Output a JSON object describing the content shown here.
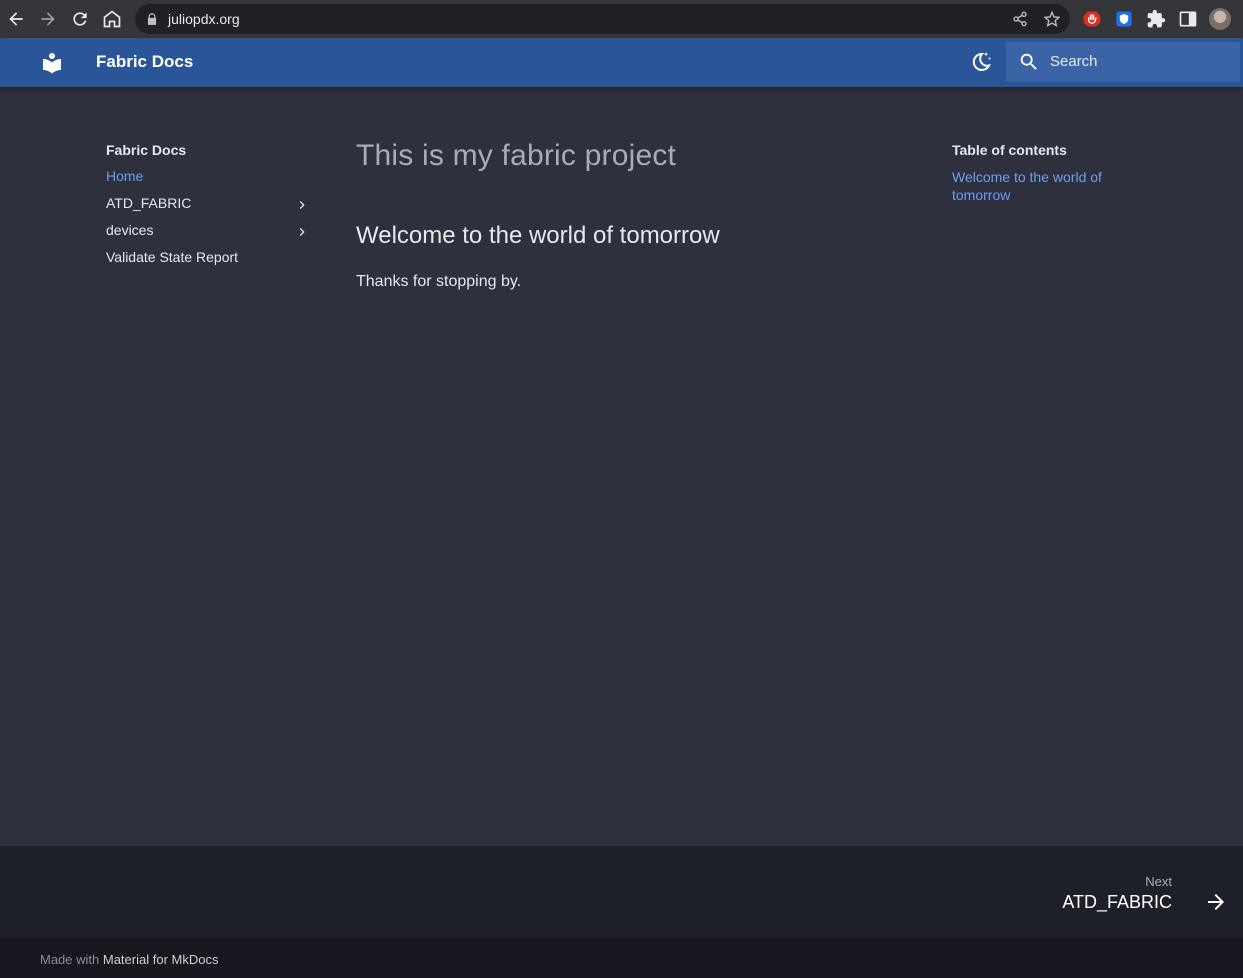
{
  "browser": {
    "url": "juliopdx.org"
  },
  "header": {
    "site_title": "Fabric Docs",
    "search_placeholder": "Search"
  },
  "nav": {
    "title": "Fabric Docs",
    "items": [
      {
        "label": "Home",
        "active": true,
        "expandable": false
      },
      {
        "label": "ATD_FABRIC",
        "active": false,
        "expandable": true
      },
      {
        "label": "devices",
        "active": false,
        "expandable": true
      },
      {
        "label": "Validate State Report",
        "active": false,
        "expandable": false
      }
    ]
  },
  "content": {
    "h1": "This is my fabric project",
    "h2": "Welcome to the world of tomorrow",
    "paragraph": "Thanks for stopping by."
  },
  "toc": {
    "title": "Table of contents",
    "items": [
      "Welcome to the world of tomorrow"
    ]
  },
  "footer": {
    "next_label": "Next",
    "next_title": "ATD_FABRIC",
    "made_with_prefix": "Made with",
    "made_with_link": "Material for MkDocs"
  },
  "colors": {
    "header": "#2a5598",
    "background": "#2e303e",
    "link": "#6c9ef0"
  }
}
